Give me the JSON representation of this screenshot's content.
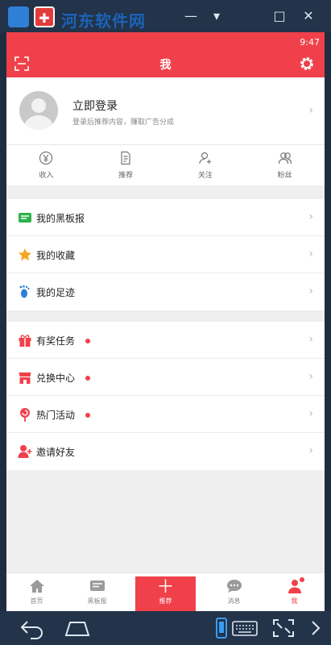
{
  "window": {
    "logo_text": "河东软件网",
    "tab2_glyph": "✚",
    "controls": [
      "—",
      "▾",
      "□",
      "✕"
    ]
  },
  "status": {
    "time": "9:47"
  },
  "header": {
    "title": "我"
  },
  "profile": {
    "login_label": "立即登录",
    "login_subtitle": "登录后推荐内容，赚取广告分成"
  },
  "stats": [
    {
      "label": "收入",
      "icon": "yuan-icon"
    },
    {
      "label": "推荐",
      "icon": "document-icon"
    },
    {
      "label": "关注",
      "icon": "add-person-icon"
    },
    {
      "label": "粉丝",
      "icon": "people-icon"
    }
  ],
  "menu_group1": [
    {
      "label": "我的黑板报",
      "icon": "blackboard-icon",
      "color": "#2fb14e"
    },
    {
      "label": "我的收藏",
      "icon": "star-icon",
      "color": "#f5a623"
    },
    {
      "label": "我的足迹",
      "icon": "footprint-icon",
      "color": "#2d7fd6"
    }
  ],
  "menu_group2": [
    {
      "label": "有奖任务",
      "icon": "gift-icon",
      "dot": true,
      "color": "#f0414a"
    },
    {
      "label": "兑换中心",
      "icon": "shop-icon",
      "dot": true,
      "color": "#f0414a"
    },
    {
      "label": "热门活动",
      "icon": "lollipop-icon",
      "dot": true,
      "color": "#f0414a"
    },
    {
      "label": "邀请好友",
      "icon": "invite-person-icon",
      "dot": false,
      "color": "#f0414a"
    }
  ],
  "tabbar": [
    {
      "label": "首页",
      "icon": "home-icon"
    },
    {
      "label": "黑板报",
      "icon": "board-icon"
    },
    {
      "label": "推荐",
      "icon": "plus-icon"
    },
    {
      "label": "消息",
      "icon": "chat-icon"
    },
    {
      "label": "我",
      "icon": "person-icon"
    }
  ],
  "colors": {
    "accent": "#f0414a",
    "chrome": "#22334a"
  }
}
